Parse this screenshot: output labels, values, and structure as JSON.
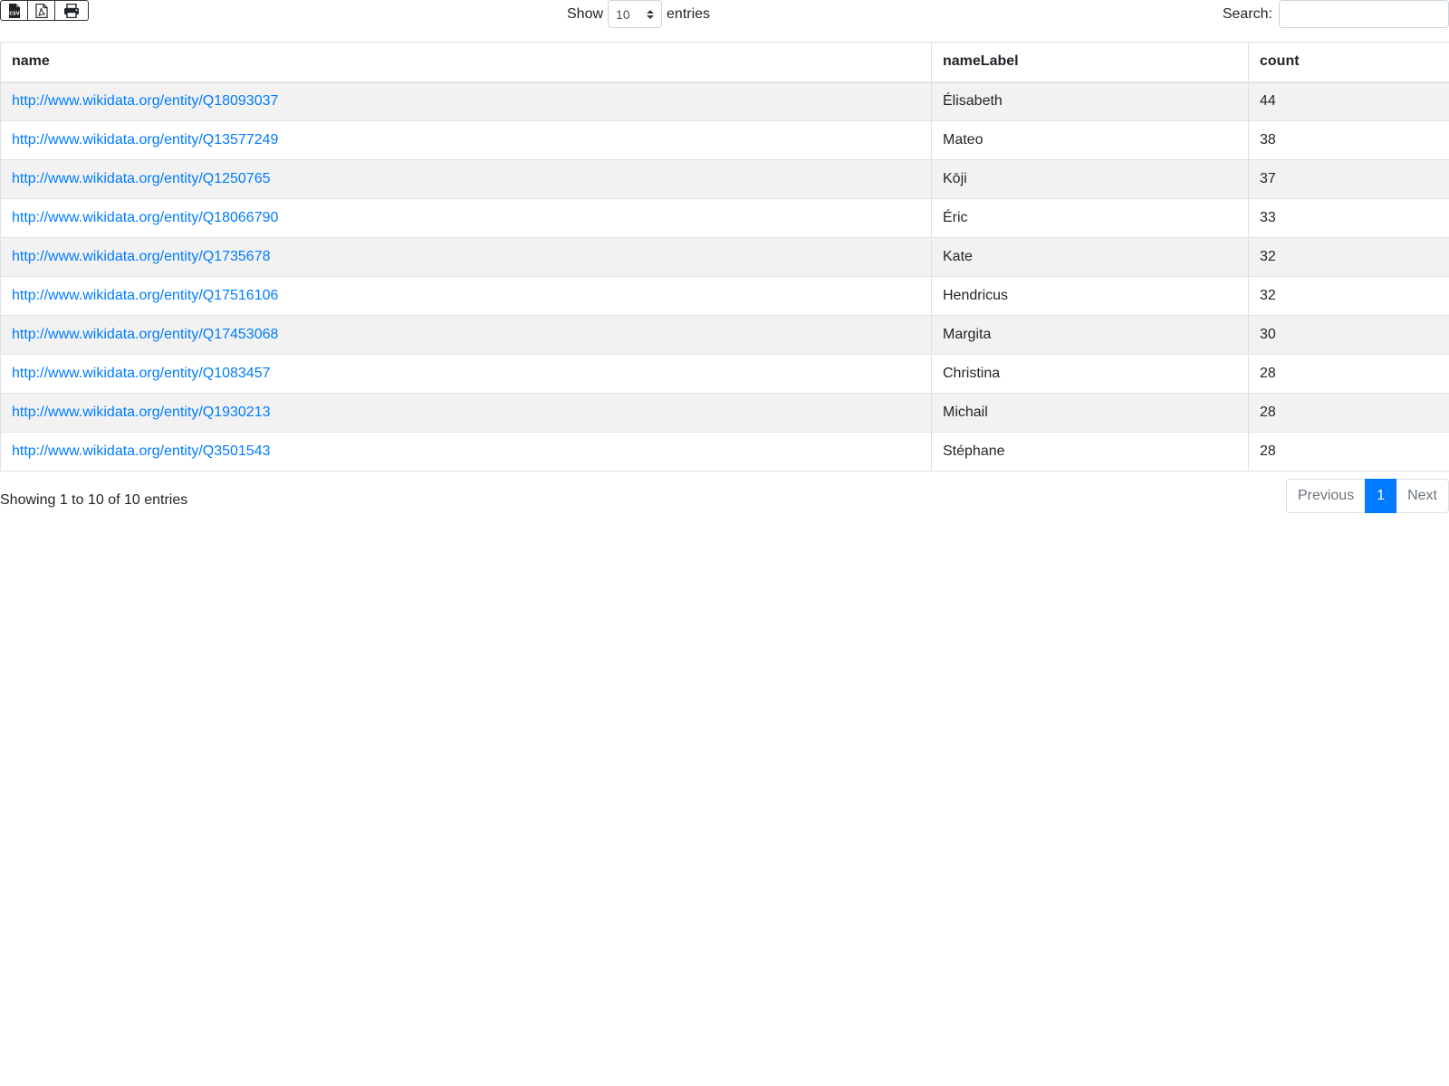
{
  "toolbar": {
    "export_buttons": [
      {
        "icon": "file-csv-icon"
      },
      {
        "icon": "file-pdf-icon"
      },
      {
        "icon": "print-icon"
      }
    ],
    "show_label": "Show",
    "entries_label": "entries",
    "page_length_value": "10",
    "search_label": "Search:",
    "search_value": ""
  },
  "table": {
    "columns": [
      "name",
      "nameLabel",
      "count"
    ],
    "rows": [
      {
        "name": "http://www.wikidata.org/entity/Q18093037",
        "nameLabel": "Élisabeth",
        "count": "44"
      },
      {
        "name": "http://www.wikidata.org/entity/Q13577249",
        "nameLabel": "Mateo",
        "count": "38"
      },
      {
        "name": "http://www.wikidata.org/entity/Q1250765",
        "nameLabel": "Kōji",
        "count": "37"
      },
      {
        "name": "http://www.wikidata.org/entity/Q18066790",
        "nameLabel": "Éric",
        "count": "33"
      },
      {
        "name": "http://www.wikidata.org/entity/Q1735678",
        "nameLabel": "Kate",
        "count": "32"
      },
      {
        "name": "http://www.wikidata.org/entity/Q17516106",
        "nameLabel": "Hendricus",
        "count": "32"
      },
      {
        "name": "http://www.wikidata.org/entity/Q17453068",
        "nameLabel": "Margita",
        "count": "30"
      },
      {
        "name": "http://www.wikidata.org/entity/Q1083457",
        "nameLabel": "Christina",
        "count": "28"
      },
      {
        "name": "http://www.wikidata.org/entity/Q1930213",
        "nameLabel": "Michail",
        "count": "28"
      },
      {
        "name": "http://www.wikidata.org/entity/Q3501543",
        "nameLabel": "Stéphane",
        "count": "28"
      }
    ]
  },
  "footer": {
    "info": "Showing 1 to 10 of 10 entries",
    "previous_label": "Previous",
    "current_page": "1",
    "next_label": "Next"
  },
  "colors": {
    "link": "#007bff",
    "active_page": "#007bff",
    "stripe": "#f2f2f2"
  }
}
